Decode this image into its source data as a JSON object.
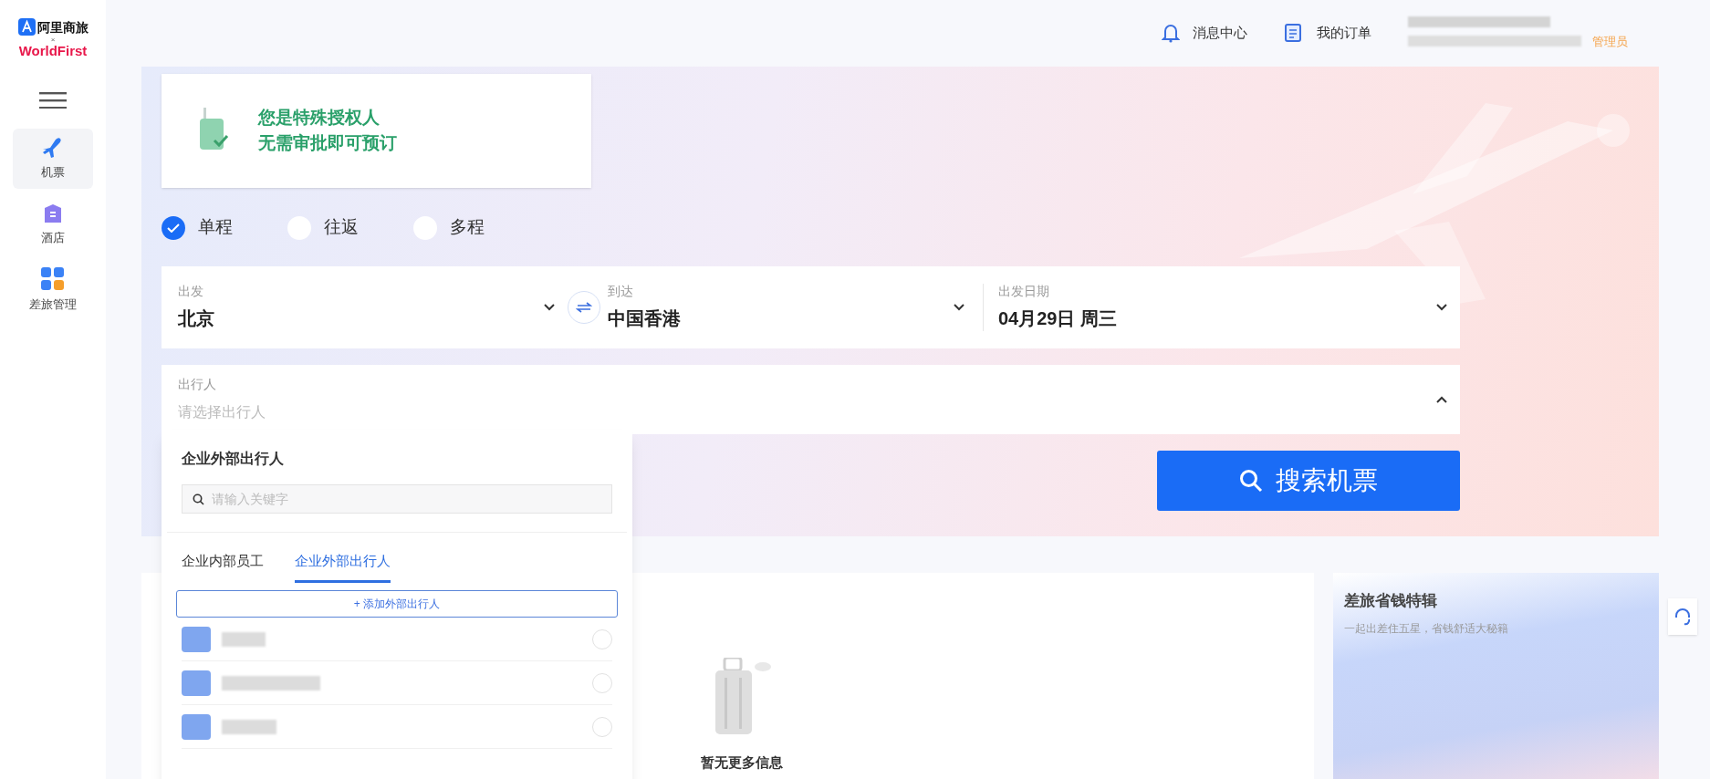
{
  "logo": {
    "brand": "阿里商旅",
    "cross": "×",
    "partner": "WorldFirst"
  },
  "sidebar": {
    "items": [
      {
        "label": "机票",
        "kind": "plane",
        "selected": true
      },
      {
        "label": "酒店",
        "kind": "hotel",
        "selected": false
      },
      {
        "label": "差旅管理",
        "kind": "grid",
        "selected": false
      }
    ]
  },
  "header": {
    "links": [
      {
        "label": "消息中心",
        "kind": "bell"
      },
      {
        "label": "我的订单",
        "kind": "orders"
      }
    ],
    "user_role": "管理员"
  },
  "notice": {
    "lines": [
      "您是特殊授权人",
      "无需审批即可预订"
    ]
  },
  "trip_types": [
    {
      "label": "单程",
      "selected": true
    },
    {
      "label": "往返",
      "selected": false
    },
    {
      "label": "多程",
      "selected": false
    }
  ],
  "route": {
    "from": {
      "label": "出发",
      "value": "北京"
    },
    "to": {
      "label": "到达",
      "value": "中国香港"
    },
    "date": {
      "label": "出发日期",
      "value": "04月29日 周三"
    }
  },
  "travelers": {
    "label": "出行人",
    "placeholder": "请选择出行人",
    "expanded": true
  },
  "search_button": "搜索机票",
  "traveler_popup": {
    "title": "企业外部出行人",
    "search_placeholder": "请输入关键字",
    "tabs": [
      {
        "label": "企业内部员工",
        "selected": false
      },
      {
        "label": "企业外部出行人",
        "selected": true
      }
    ],
    "add_button": "+ 添加外部出行人",
    "people": [
      {
        "selected": false
      },
      {
        "selected": false
      },
      {
        "selected": false
      }
    ]
  },
  "empty_state": "暂无更多信息",
  "promo": {
    "title": "差旅省钱特辑",
    "subtitle": "一起出差住五星，省钱舒适大秘籍"
  }
}
